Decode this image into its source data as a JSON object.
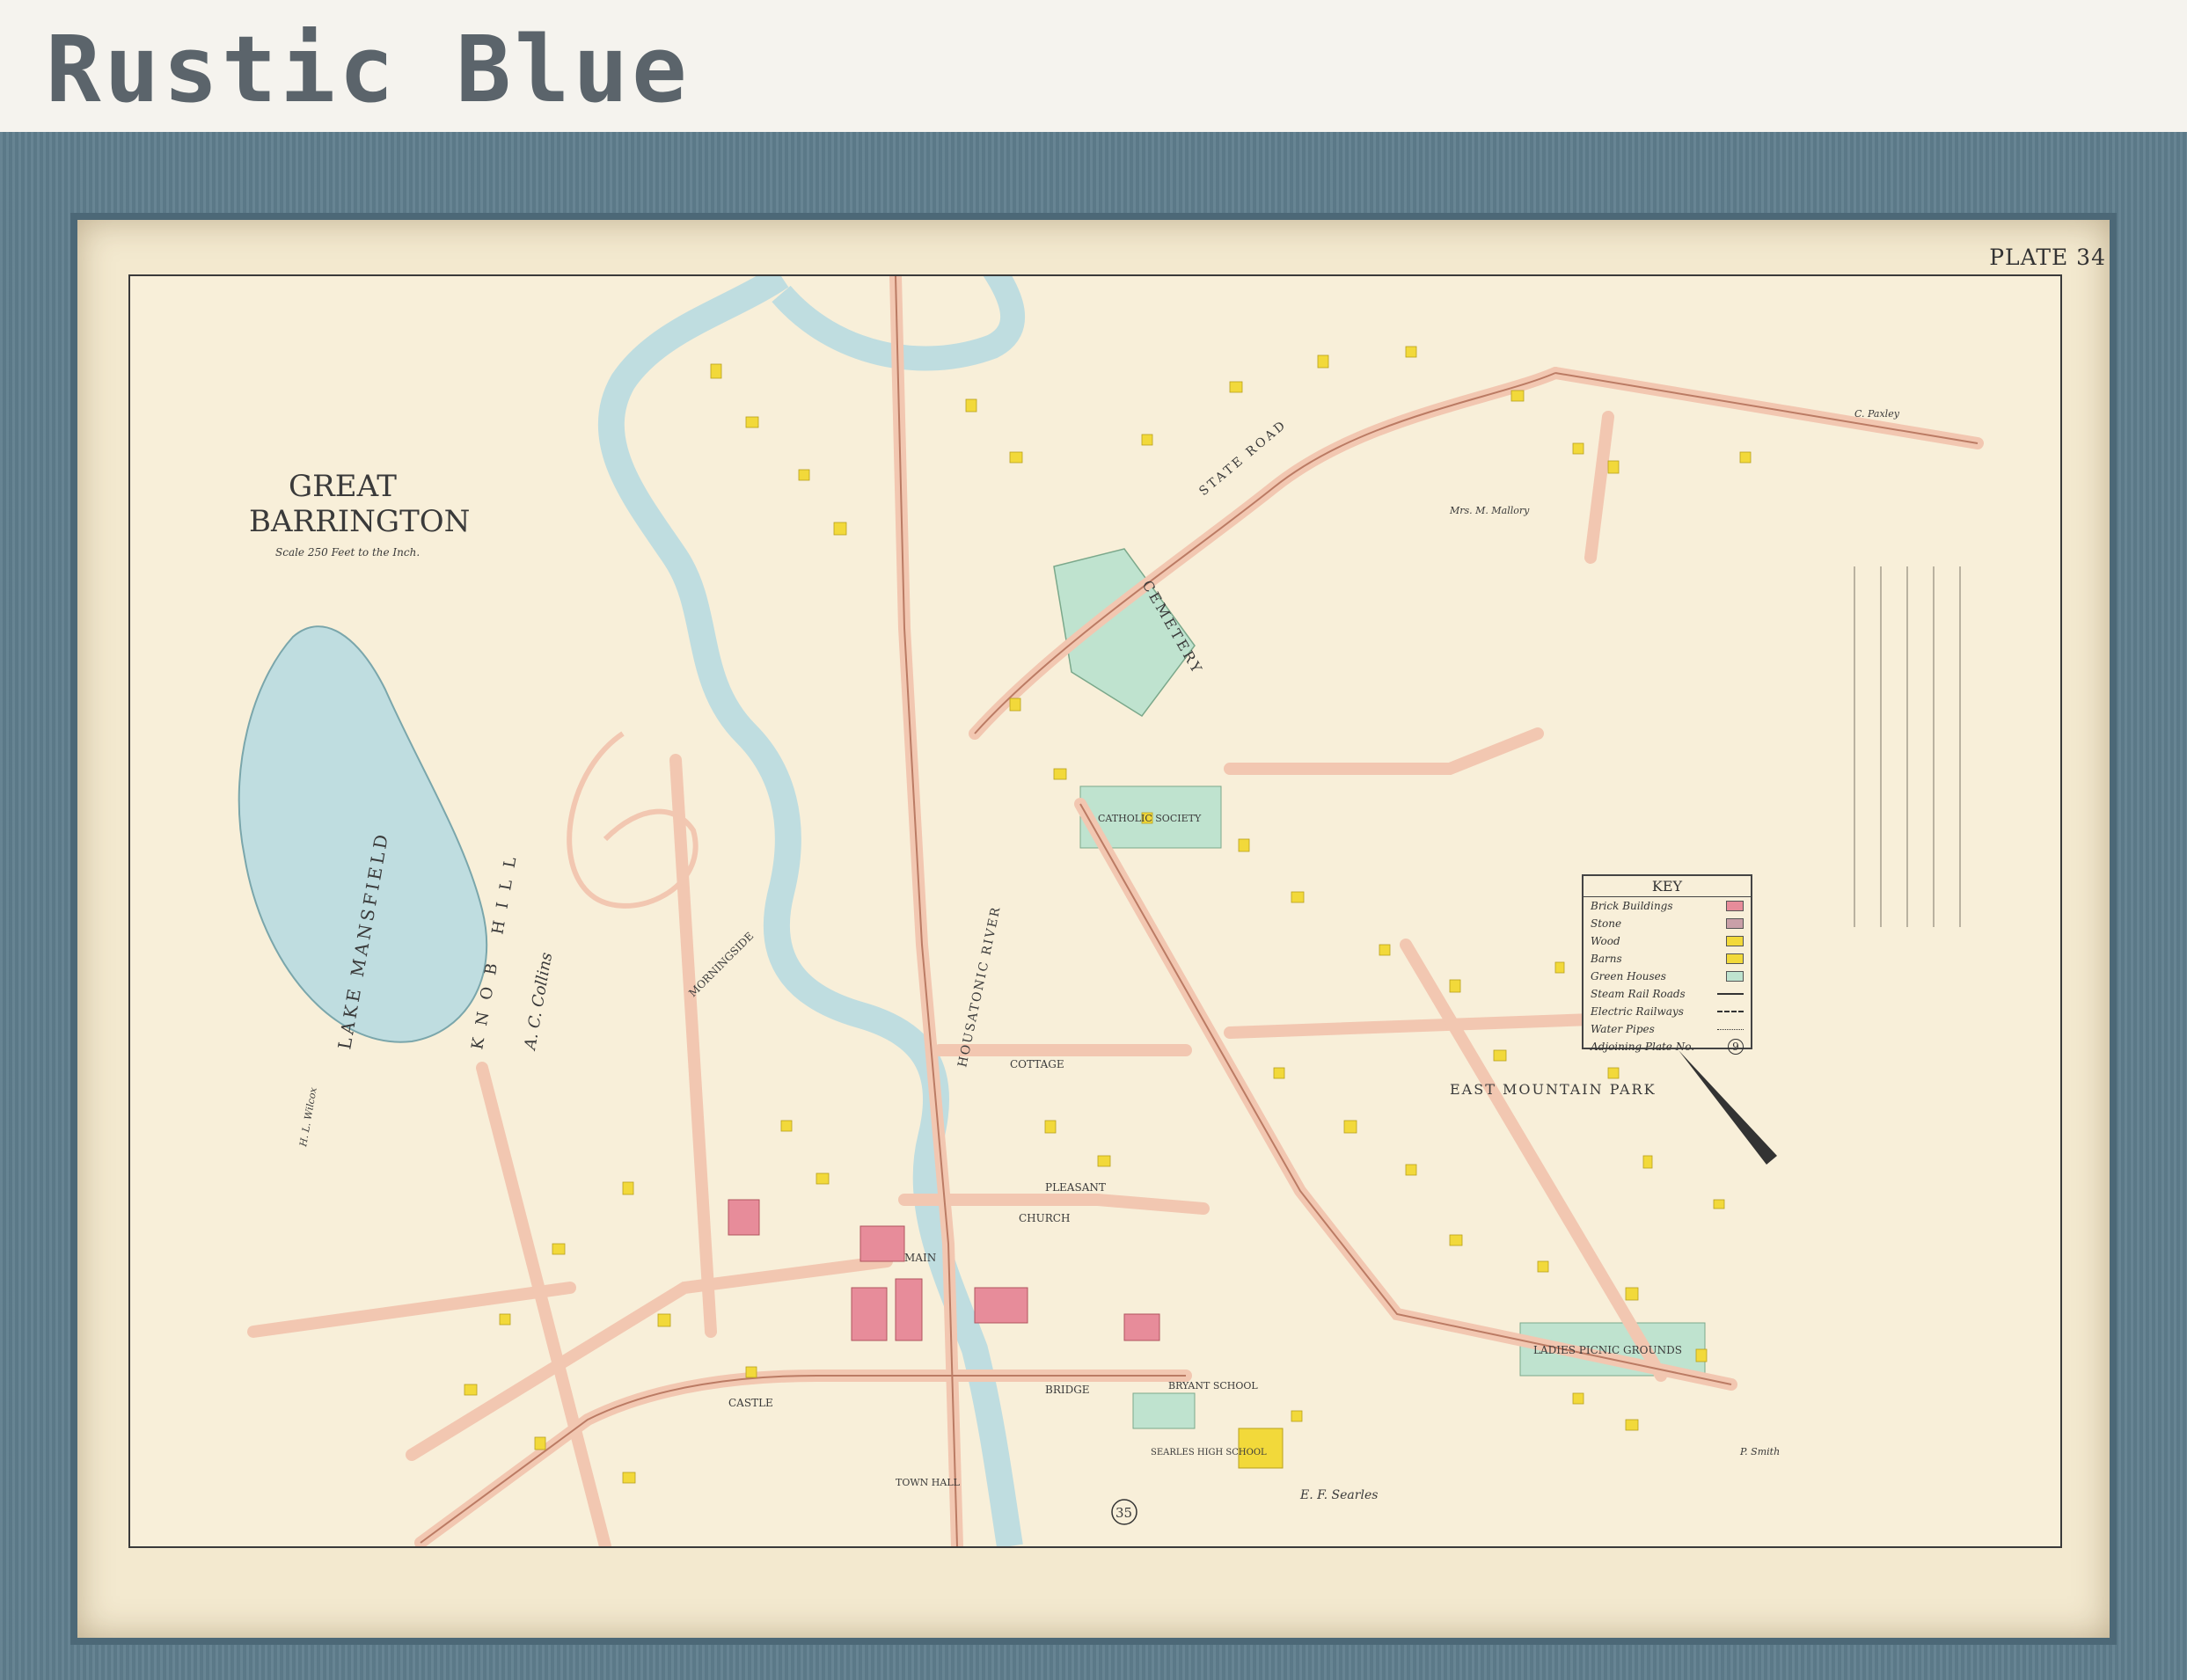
{
  "header": {
    "title": "Rustic Blue"
  },
  "map": {
    "plate": "PLATE 34",
    "town": [
      "GREAT",
      "BARRINGTON"
    ],
    "scale": "Scale 250 Feet to the Inch.",
    "adjoining_plate": "35",
    "labels": {
      "lake": "LAKE  MANSFIELD",
      "hill": "KNOB  HILL",
      "cemetery": "CEMETERY",
      "river": "HOUSATONIC  RIVER",
      "park": "EAST  MOUNTAIN  PARK",
      "picnic": "LADIES PICNIC GROUNDS",
      "catholic": "CATHOLIC SOCIETY",
      "state_road": "STATE  ROAD",
      "main": "MAIN",
      "castle": "CASTLE",
      "bridge": "BRIDGE",
      "church": "CHURCH",
      "cottage": "COTTAGE",
      "pleasant": "PLEASANT",
      "bryant": "BRYANT SCHOOL",
      "searles": "SEARLES HIGH SCHOOL",
      "town_hall": "TOWN HALL",
      "morningside": "MORNINGSIDE",
      "ac_collins": "A. C. Collins",
      "ef_searles": "E. F. Searles",
      "mrs_mallory": "Mrs. M. Mallory",
      "p_smith": "P. Smith",
      "c_paxley": "C. Paxley",
      "hl_wilcox": "H. L. Wilcox"
    },
    "key": {
      "title": "KEY",
      "rows": [
        {
          "label": "Brick Buildings",
          "color": "#e78c9a"
        },
        {
          "label": "Stone",
          "color": "#c9a0a8"
        },
        {
          "label": "Wood",
          "color": "#f2d93a"
        },
        {
          "label": "Barns",
          "color": "#f2d93a"
        },
        {
          "label": "Green Houses",
          "color": "#bfe3cf"
        },
        {
          "label": "Steam Rail Roads",
          "color": ""
        },
        {
          "label": "Electric Railways",
          "color": ""
        },
        {
          "label": "Water Pipes",
          "color": ""
        },
        {
          "label": "Adjoining Plate No.",
          "color": ""
        }
      ],
      "adjoining_number": "9"
    },
    "colors": {
      "paper": "#f8efd9",
      "water": "#bfdde0",
      "road": "#f2c7b1",
      "wood": "#f2d93a",
      "brick": "#e78c9a",
      "green": "#bfe3cf"
    }
  }
}
